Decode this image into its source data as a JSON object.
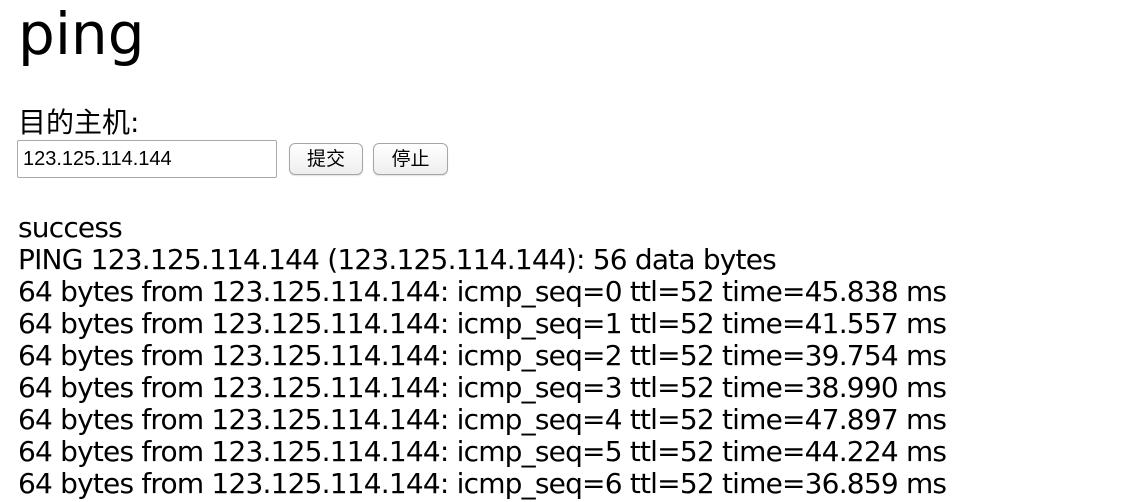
{
  "page": {
    "title": "ping"
  },
  "form": {
    "label": "目的主机:",
    "host_value": "123.125.114.144",
    "submit_label": "提交",
    "stop_label": "停止"
  },
  "output": {
    "status": "success",
    "lines": [
      "PING 123.125.114.144 (123.125.114.144): 56 data bytes",
      "64 bytes from 123.125.114.144: icmp_seq=0 ttl=52 time=45.838 ms",
      "64 bytes from 123.125.114.144: icmp_seq=1 ttl=52 time=41.557 ms",
      "64 bytes from 123.125.114.144: icmp_seq=2 ttl=52 time=39.754 ms",
      "64 bytes from 123.125.114.144: icmp_seq=3 ttl=52 time=38.990 ms",
      "64 bytes from 123.125.114.144: icmp_seq=4 ttl=52 time=47.897 ms",
      "64 bytes from 123.125.114.144: icmp_seq=5 ttl=52 time=44.224 ms",
      "64 bytes from 123.125.114.144: icmp_seq=6 ttl=52 time=36.859 ms"
    ]
  }
}
